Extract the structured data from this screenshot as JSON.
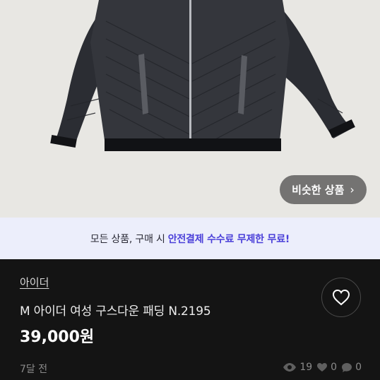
{
  "photo": {
    "alt": ""
  },
  "similar_button": {
    "label": "비슷한 상품",
    "chevron": "›"
  },
  "promo": {
    "prefix": "모든 상품, 구매 시",
    "highlight": "안전결제 수수료 무제한 무료!"
  },
  "product": {
    "brand": "아이더",
    "title": "M 아이더 여성 구스다운 패딩 N.2195",
    "price": "39,000원",
    "posted": "7달 전"
  },
  "stats": {
    "views": "19",
    "likes": "0",
    "chats": "0"
  },
  "icons": {
    "like": "heart-icon",
    "views": "eye-icon",
    "likes": "heart-icon",
    "chats": "chat-bubble-icon"
  },
  "colors": {
    "accent": "#4a3fd9",
    "background": "#141414",
    "promo_bg": "#eceefb"
  }
}
